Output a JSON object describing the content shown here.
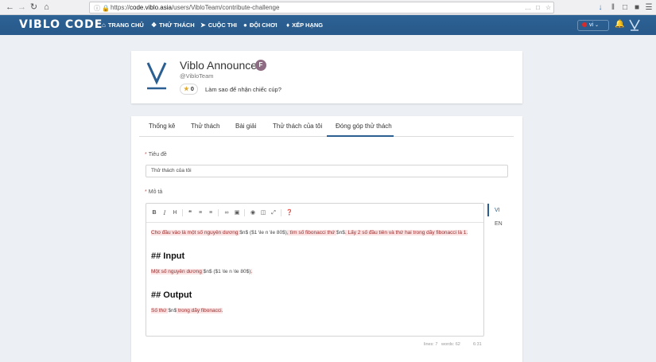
{
  "browser": {
    "url_host": "code.viblo.asia",
    "url_scheme": "https://",
    "url_path": "/users/VibloTeam/contribute-challenge",
    "url_more": "…",
    "back_icon": "arrow-left",
    "forward_icon": "arrow-right",
    "reload_icon": "reload"
  },
  "header": {
    "logo_text": "VIBLO CODE",
    "menu": [
      {
        "icon": "home",
        "label": "TRANG CHỦ"
      },
      {
        "icon": "puzzle",
        "label": "THỬ THÁCH"
      },
      {
        "icon": "rocket",
        "label": "CUỘC THI"
      },
      {
        "icon": "team",
        "label": "ĐỘI CHƠI"
      },
      {
        "icon": "trophy",
        "label": "XẾP HẠNG"
      }
    ],
    "language": "vi",
    "accent": "#2b5f91"
  },
  "profile": {
    "name": "Viblo Announcer",
    "badge": "F",
    "handle": "@VibloTeam",
    "cups": "0",
    "cup_link": "Làm sao để nhận chiếc cúp?"
  },
  "tabs": [
    "Thống kê",
    "Thử thách",
    "Bài giải",
    "Thử thách của tôi",
    "Đóng góp thử thách"
  ],
  "form": {
    "title_label": "Tiêu đề",
    "title_value": "Thử thách của tôi",
    "desc_label": "Mô tả",
    "required_mark": "*",
    "content": {
      "line1_a": "Cho đầu vào là một số nguyên dương ",
      "line1_b": "$n$ ($1 \\le n \\le 80$)",
      "line1_c": ", tìm số fibonacci thứ ",
      "line1_d": "$n$",
      "line1_e": ". Lấy 2 số đầu tiên và thứ hai trong dãy fibonacci là 1.",
      "h_input": "## Input",
      "line2_a": "Một số nguyên dương ",
      "line2_b": "$n$ ($1 \\le n \\le 80$)",
      "line2_c": ".",
      "h_output": "## Output",
      "line3_a": "Số thứ ",
      "line3_b": "$n$",
      "line3_c": " trong dãy fibonacci."
    },
    "status": {
      "lines": "lines: 7",
      "words": "words: 62",
      "cursor": "6:31"
    },
    "languages": [
      "VI",
      "EN"
    ]
  }
}
